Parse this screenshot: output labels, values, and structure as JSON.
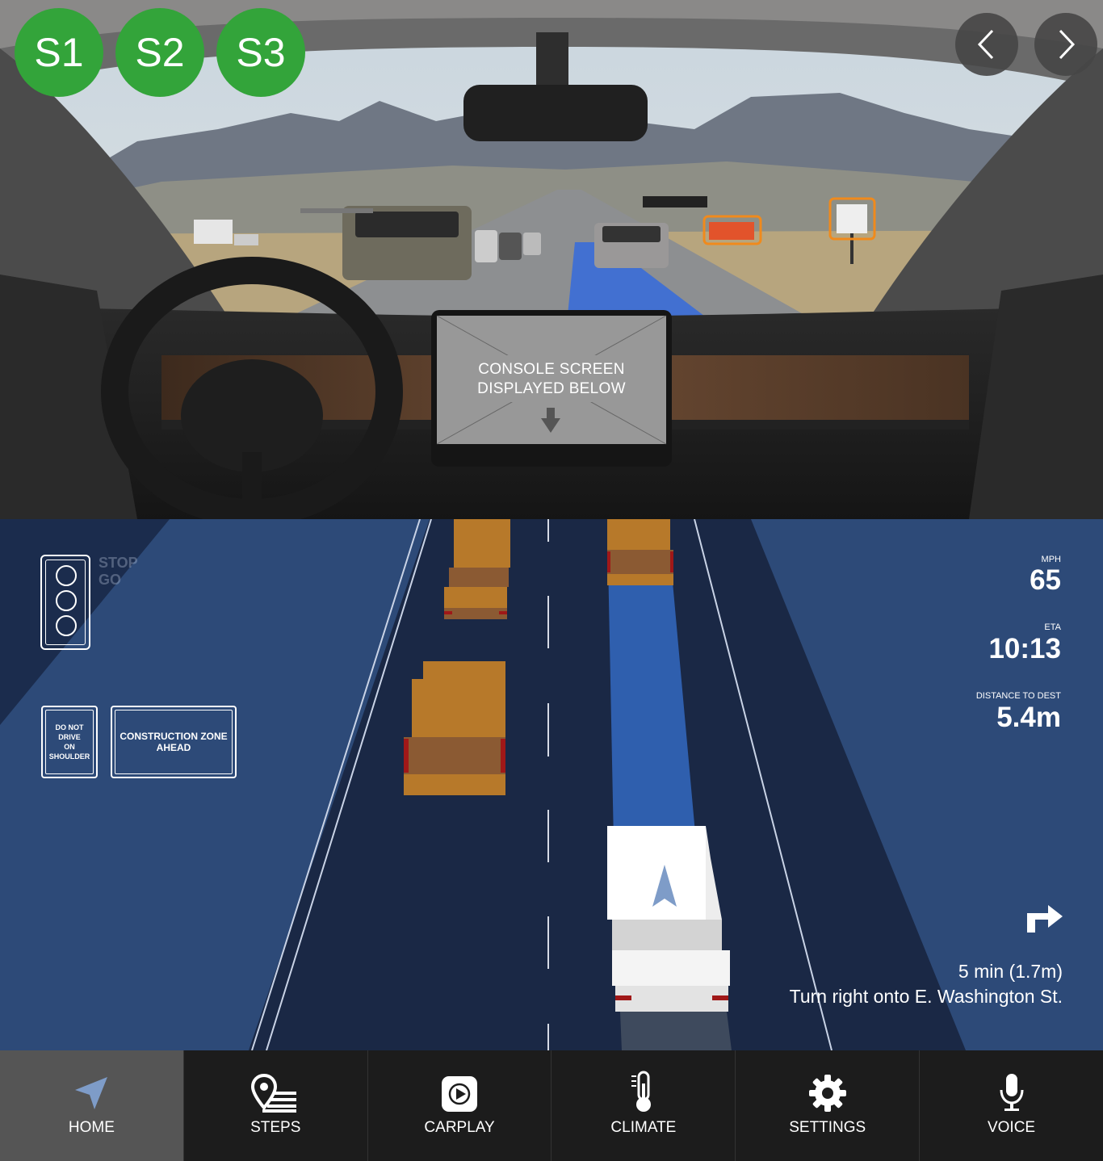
{
  "scene_buttons": [
    "S1",
    "S2",
    "S3"
  ],
  "console_overlay": {
    "line1": "CONSOLE SCREEN",
    "line2": "DISPLAYED BELOW"
  },
  "traffic_light": {
    "stop": "STOP",
    "go": "GO"
  },
  "signs": {
    "shoulder": [
      "DO NOT",
      "DRIVE",
      "ON",
      "SHOULDER"
    ],
    "construction": [
      "CONSTRUCTION ZONE",
      "AHEAD"
    ]
  },
  "stats": {
    "speed": {
      "label": "MPH",
      "value": "65"
    },
    "eta": {
      "label": "ETA",
      "value": "10:13"
    },
    "distance": {
      "label": "DISTANCE TO DEST",
      "value": "5.4m"
    }
  },
  "directions": {
    "time": "5 min (1.7m)",
    "instruction": "Turn right onto E. Washington St."
  },
  "nav": [
    {
      "label": "HOME",
      "icon": "navigation-arrow-icon",
      "active": true
    },
    {
      "label": "STEPS",
      "icon": "steps-pin-list-icon"
    },
    {
      "label": "CARPLAY",
      "icon": "carplay-icon"
    },
    {
      "label": "CLIMATE",
      "icon": "thermometer-icon"
    },
    {
      "label": "SETTINGS",
      "icon": "gear-icon"
    },
    {
      "label": "VOICE",
      "icon": "microphone-icon"
    }
  ],
  "colors": {
    "scene_button": "#33a43a",
    "map_bg": "#2d4a78",
    "road": "#1a2845",
    "route": "#2f5fae",
    "car": "#b7792a",
    "highlight_box": "#f08a1c",
    "nav_bg": "#1c1c1c",
    "nav_active": "#555555"
  }
}
